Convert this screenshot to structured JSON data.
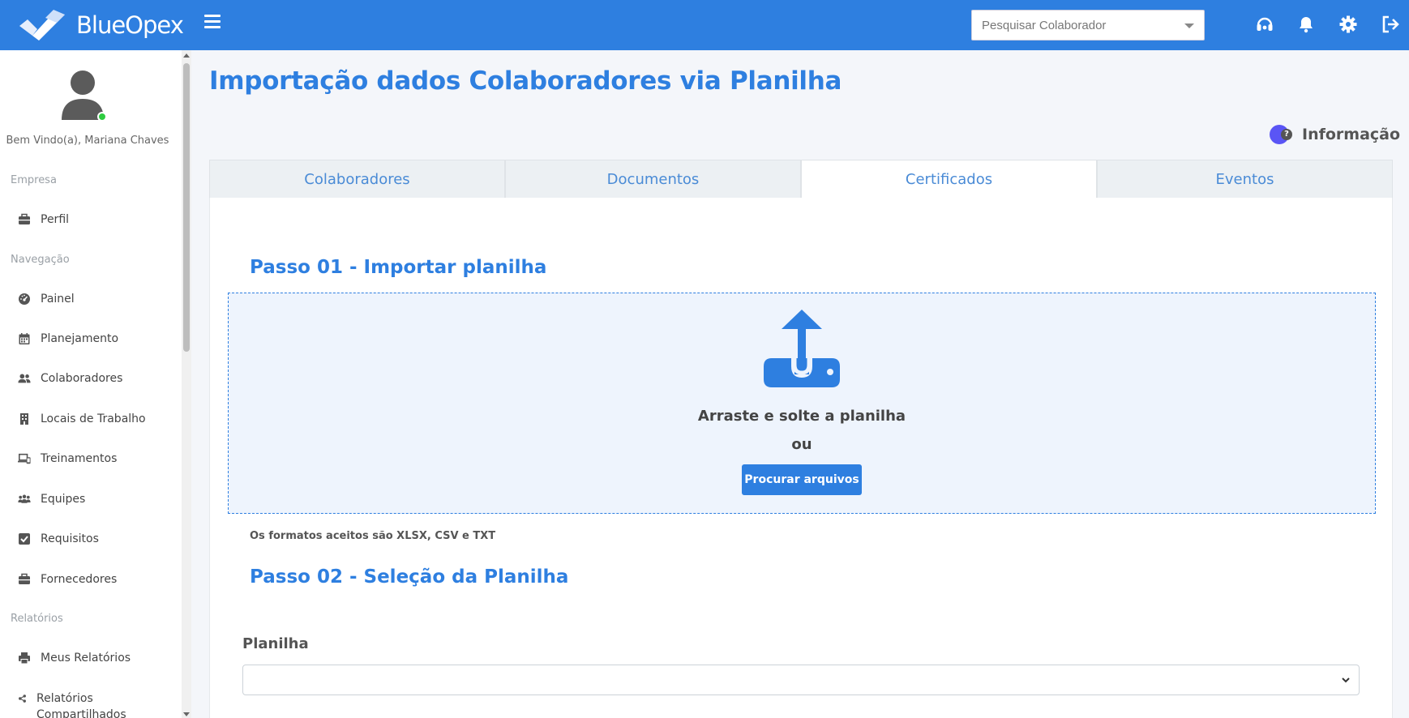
{
  "app": {
    "brand": "BlueOpex",
    "brand_color": "#2e7fe0"
  },
  "topbar": {
    "search_placeholder": "Pesquisar Colaborador",
    "icons": [
      "headset-icon",
      "bell-icon",
      "gear-icon",
      "logout-icon"
    ]
  },
  "sidebar": {
    "welcome": "Bem Vindo(a), Mariana Chaves",
    "sections": {
      "empresa": "Empresa",
      "navegacao": "Navegação",
      "relatorios": "Relatórios"
    },
    "items": {
      "perfil": "Perfil",
      "painel": "Painel",
      "planejamento": "Planejamento",
      "colaboradores": "Colaboradores",
      "locais": "Locais de Trabalho",
      "treinamentos": "Treinamentos",
      "equipes": "Equipes",
      "requisitos": "Requisitos",
      "fornecedores": "Fornecedores",
      "meus_relatorios": "Meus Relatórios",
      "relatorios_compartilhados": "Relatórios Compartilhados"
    }
  },
  "main": {
    "title": "Importação dados Colaboradores via Planilha",
    "info_label": "Informação",
    "tabs": {
      "colaboradores": "Colaboradores",
      "documentos": "Documentos",
      "certificados": "Certificados",
      "eventos": "Eventos"
    },
    "active_tab": "Certificados",
    "step1_title": "Passo 01 - Importar planilha",
    "drop_text": "Arraste e solte a planilha",
    "or_text": "ou",
    "browse_label": "Procurar arquivos",
    "formats_text": "Os formatos aceitos são XLSX, CSV e TXT",
    "step2_title": "Passo 02 - Seleção da Planilha",
    "sheet_label": "Planilha",
    "sheet_value": ""
  }
}
